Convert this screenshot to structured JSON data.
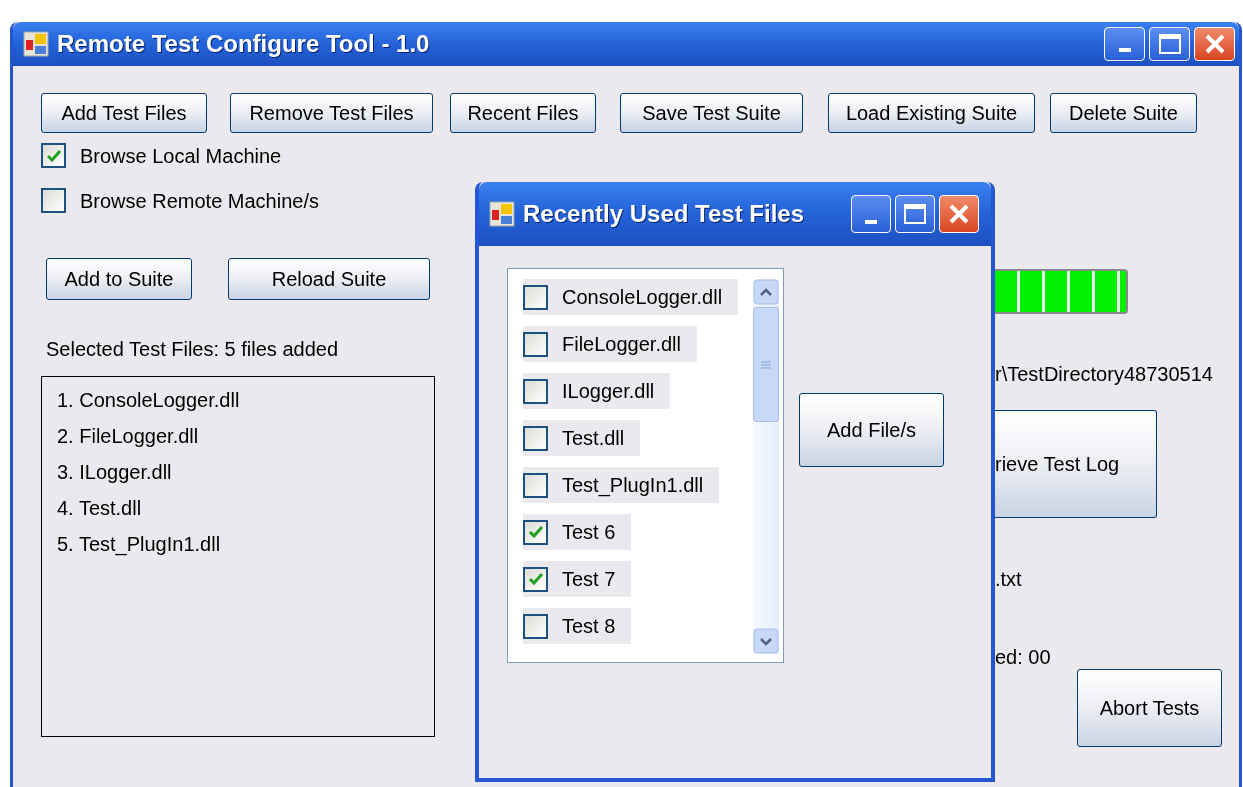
{
  "window": {
    "title": "Remote Test Configure Tool - 1.0",
    "toolbar_buttons": [
      "Add Test Files",
      "Remove Test Files",
      "Recent Files",
      "Save Test Suite",
      "Load Existing Suite",
      "Delete Suite"
    ],
    "browse_options": [
      {
        "label": "Browse Local Machine",
        "checked": true
      },
      {
        "label": "Browse Remote Machine/s",
        "checked": false
      }
    ],
    "suite_buttons": [
      "Add to Suite",
      "Reload Suite"
    ],
    "selected_files_label": "Selected Test Files: 5 files added",
    "selected_files": [
      "1. ConsoleLogger.dll",
      "2. FileLogger.dll",
      "3. ILogger.dll",
      "4. Test.dll",
      "5. Test_PlugIn1.dll"
    ],
    "progress": {
      "level": 1
    },
    "directory_text": "r\\TestDirectory48730514",
    "log_button": "rieve Test Log",
    "log_file_text": ".txt",
    "counter_text": "ed: 00",
    "abort_button": "Abort Tests"
  },
  "dialog": {
    "title": "Recently Used Test Files",
    "files": [
      {
        "label": "ConsoleLogger.dll",
        "checked": false
      },
      {
        "label": "FileLogger.dll",
        "checked": false
      },
      {
        "label": "ILogger.dll",
        "checked": false
      },
      {
        "label": "Test.dll",
        "checked": false
      },
      {
        "label": "Test_PlugIn1.dll",
        "checked": false
      },
      {
        "label": "Test 6",
        "checked": true
      },
      {
        "label": "Test 7",
        "checked": true
      },
      {
        "label": "Test 8",
        "checked": false
      }
    ],
    "add_button": "Add File/s"
  }
}
